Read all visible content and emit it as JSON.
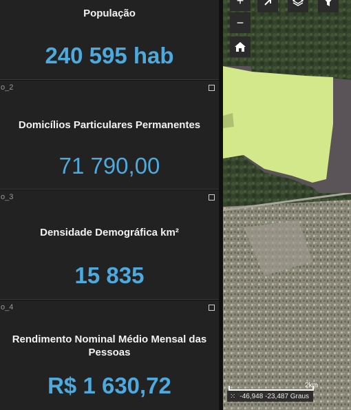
{
  "cards": [
    {
      "id": "",
      "title": "População",
      "value": "240 595 hab",
      "value_color": "#4ea9dd"
    },
    {
      "id": "o_2",
      "title": "Domicílios Particulares Permanentes",
      "value": "71 790,00",
      "value_color": "#4ea9dd"
    },
    {
      "id": "o_3",
      "title": "Densidade Demográfica km²",
      "value": "15 835",
      "value_color": "#4ea9dd"
    },
    {
      "id": "o_4",
      "title": "Rendimento Nominal Médio Mensal das Pessoas",
      "value": "R$  1 630,72",
      "value_color": "#4ea9dd"
    }
  ],
  "map": {
    "toolbar": {
      "zoom_in": "+",
      "zoom_out": "−",
      "home_icon": "home-icon",
      "compass_icon": "compass-icon",
      "layers_icon": "layers-icon",
      "filter_icon": "filter-icon"
    },
    "scale_label": "2km",
    "coordinates": "-46,948 -23,487 Graus",
    "overlay_colors": {
      "green_area": "#d2e88a",
      "gray_area": "#5a5458"
    }
  }
}
